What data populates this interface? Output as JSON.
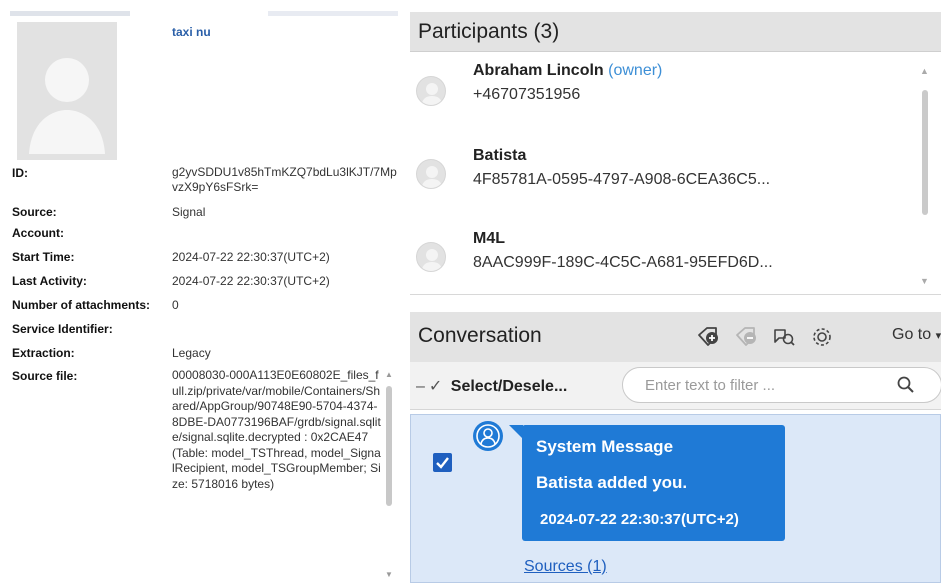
{
  "details": {
    "name": "taxi nu",
    "fields": [
      {
        "label": "ID:",
        "value": "g2yvSDDU1v85hTmKZQ7bdLu3lKJT/7MpvzX9pY6sFSrk="
      },
      {
        "label": "Source:",
        "value": "Signal"
      },
      {
        "label": "Account:",
        "value": ""
      },
      {
        "label": "Start Time:",
        "value": "2024-07-22 22:30:37(UTC+2)"
      },
      {
        "label": "Last Activity:",
        "value": "2024-07-22 22:30:37(UTC+2)"
      },
      {
        "label": "Number of attachments:",
        "value": "0"
      },
      {
        "label": "Service Identifier:",
        "value": ""
      },
      {
        "label": "Extraction:",
        "value": "Legacy"
      },
      {
        "label": "Source file:",
        "value": "00008030-000A113E0E60802E_files_full.zip/private/var/mobile/Containers/Shared/AppGroup/90748E90-5704-4374-8DBE-DA0773196BAF/grdb/signal.sqlite/signal.sqlite.decrypted : 0x2CAE47 (Table: model_TSThread, model_SignalRecipient, model_TSGroupMember; Size: 5718016 bytes)"
      }
    ]
  },
  "participants": {
    "title": "Participants (3)",
    "owner_label": "(owner)",
    "items": [
      {
        "name": "Abraham Lincoln",
        "is_owner": true,
        "identifier": "+46707351956"
      },
      {
        "name": "Batista",
        "is_owner": false,
        "identifier": "4F85781A-0595-4797-A908-6CEA36C5..."
      },
      {
        "name": "M4L",
        "is_owner": false,
        "identifier": "8AAC999F-189C-4C5C-A681-95EFD6D..."
      }
    ]
  },
  "conversation": {
    "title": "Conversation",
    "goto_label": "Go to",
    "select_label": "Select/Desele...",
    "filter_placeholder": "Enter text to filter ...",
    "message": {
      "sender": "System Message",
      "text": "Batista added you.",
      "timestamp": "2024-07-22 22:30:37(UTC+2)",
      "checked": true,
      "sources_label": "Sources (1)"
    }
  },
  "colors": {
    "accent": "#1f7ad6",
    "selection_bg": "#dce8f8",
    "owner_text": "#3d8fd6",
    "header_bg": "#e3e3e3"
  }
}
